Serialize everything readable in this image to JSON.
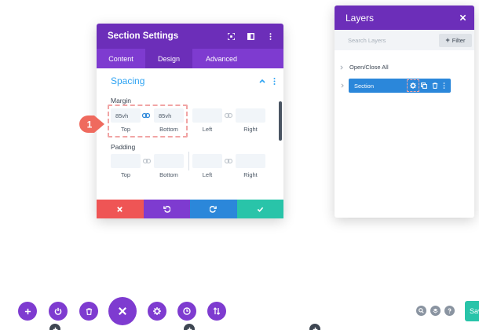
{
  "settings_modal": {
    "title": "Section Settings",
    "tabs": [
      {
        "label": "Content",
        "active": false
      },
      {
        "label": "Design",
        "active": true
      },
      {
        "label": "Advanced",
        "active": false
      }
    ],
    "group_title": "Spacing",
    "margin": {
      "label": "Margin",
      "top_value": "85vh",
      "bottom_value": "85vh",
      "left_value": "",
      "right_value": "",
      "labels": {
        "top": "Top",
        "bottom": "Bottom",
        "left": "Left",
        "right": "Right"
      }
    },
    "padding": {
      "label": "Padding",
      "labels": {
        "top": "Top",
        "bottom": "Bottom",
        "left": "Left",
        "right": "Right"
      }
    },
    "action_colors": {
      "cancel": "#ef5555",
      "undo": "#7e3bd0",
      "redo": "#2b87da",
      "save": "#29c4a9"
    }
  },
  "callout": {
    "number": "1",
    "color": "#ef6a5e"
  },
  "layers_panel": {
    "title": "Layers",
    "search_placeholder": "Search Layers",
    "filter_label": "Filter",
    "open_close_label": "Open/Close All",
    "section_label": "Section"
  },
  "bottom_bar": {
    "save_label": "Sav"
  },
  "colors": {
    "purple": "#6c2eb9",
    "purple_light": "#7e3bd0",
    "blue": "#2b87da",
    "teal": "#29c4a9"
  }
}
